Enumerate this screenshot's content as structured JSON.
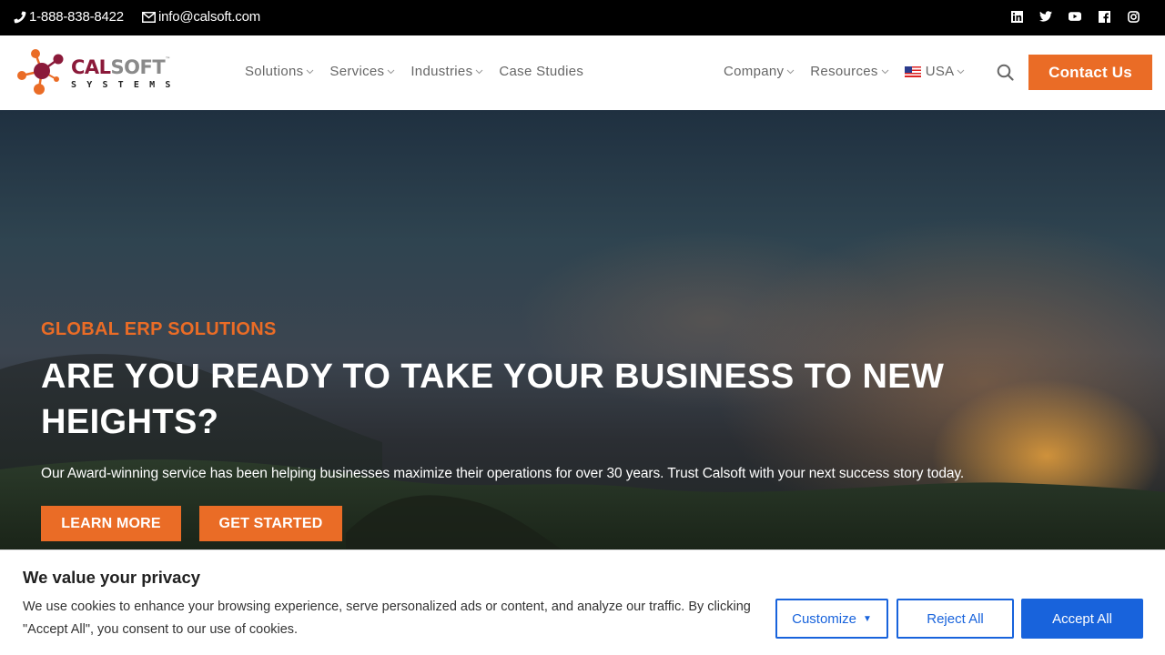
{
  "topbar": {
    "phone": "1-888-838-8422",
    "email": "info@calsoft.com",
    "social": [
      {
        "name": "linkedin",
        "icon": "linkedin-icon"
      },
      {
        "name": "twitter",
        "icon": "twitter-icon"
      },
      {
        "name": "youtube",
        "icon": "youtube-icon"
      },
      {
        "name": "facebook",
        "icon": "facebook-icon"
      },
      {
        "name": "instagram",
        "icon": "instagram-icon"
      }
    ]
  },
  "header": {
    "logo": {
      "brand_primary": "CAL",
      "brand_secondary": "SOFT",
      "trademark": "™",
      "tagline": "SYSTEMS"
    },
    "nav_left": [
      {
        "label": "Solutions",
        "has_dropdown": true
      },
      {
        "label": "Services",
        "has_dropdown": true
      },
      {
        "label": "Industries",
        "has_dropdown": true
      },
      {
        "label": "Case Studies",
        "has_dropdown": false
      }
    ],
    "nav_right": [
      {
        "label": "Company",
        "has_dropdown": true
      },
      {
        "label": "Resources",
        "has_dropdown": true
      }
    ],
    "region": {
      "label": "USA",
      "flag": "us-flag-icon"
    },
    "contact_button": "Contact Us"
  },
  "hero": {
    "eyebrow": "GLOBAL ERP SOLUTIONS",
    "headline": "ARE YOU READY TO TAKE YOUR BUSINESS TO NEW HEIGHTS?",
    "lead": "Our Award-winning service has been helping businesses maximize their operations for over 30 years. Trust Calsoft with your next success story today.",
    "buttons": {
      "learn_more": "LEARN MORE",
      "get_started": "GET STARTED"
    }
  },
  "cookie_banner": {
    "title": "We value your privacy",
    "description": "We use cookies to enhance your browsing experience, serve personalized ads or content, and analyze our traffic. By clicking \"Accept All\", you consent to our use of cookies.",
    "customize": "Customize",
    "reject": "Reject All",
    "accept": "Accept All"
  },
  "colors": {
    "accent_orange": "#ea6c26",
    "brand_maroon": "#8b1a3a",
    "cookie_blue": "#1863dc",
    "topbar_bg": "#000000"
  }
}
